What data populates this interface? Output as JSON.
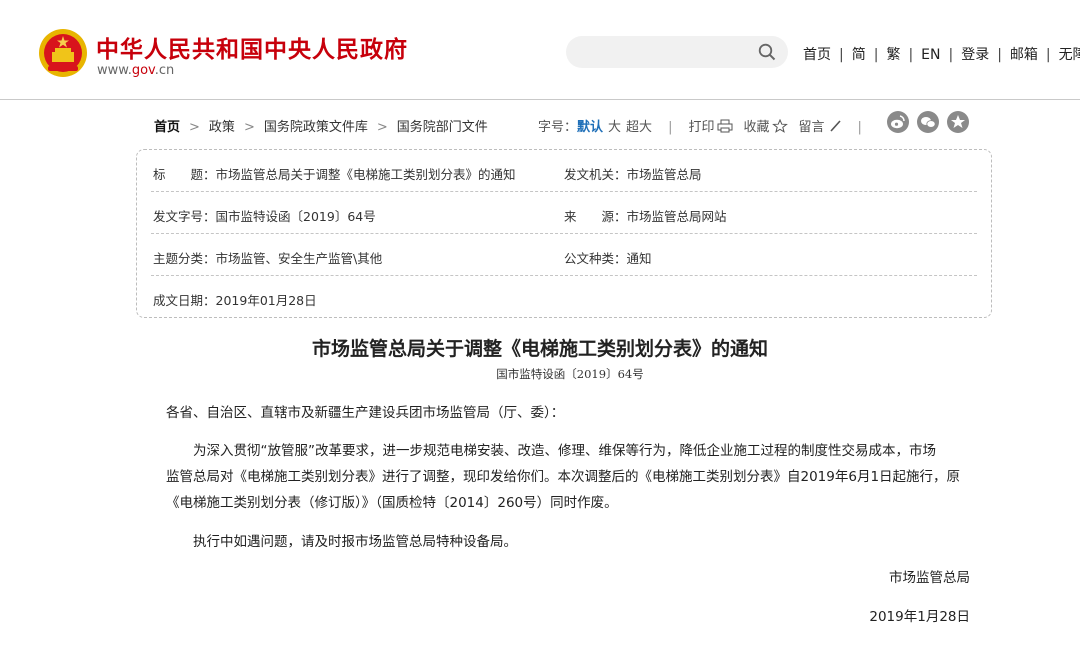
{
  "header": {
    "site_title": "中华人民共和国中央人民政府",
    "site_url_prefix": "www.",
    "site_url_domain": "gov",
    "site_url_suffix": ".cn",
    "nav": [
      "首页",
      "简",
      "繁",
      "EN",
      "登录",
      "邮箱",
      "无障碍"
    ],
    "search_placeholder": "",
    "colors": {
      "brand_red": "#c7000b",
      "link_blue": "#1f6fb8"
    }
  },
  "breadcrumb": [
    "首页",
    "政策",
    "国务院政策文件库",
    "国务院部门文件"
  ],
  "tools": {
    "font_label": "字号：",
    "font_default": "默认",
    "font_large": "大",
    "font_xlarge": "超大",
    "print": "打印",
    "favorite": "收藏",
    "comment": "留言",
    "share_icons": [
      "weibo-icon",
      "wechat-icon",
      "qzone-icon"
    ]
  },
  "info": {
    "title_key": "标　　题：",
    "title_val": "市场监管总局关于调整《电梯施工类别划分表》的通知",
    "issuer_key": "发文机关：",
    "issuer_val": "市场监管总局",
    "docno_key": "发文字号：",
    "docno_val": "国市监特设函〔2019〕64号",
    "source_key": "来　　源：",
    "source_val": "市场监管总局网站",
    "subject_key": "主题分类：",
    "subject_val": "市场监管、安全生产监管\\其他",
    "type_key": "公文种类：",
    "type_val": "通知",
    "date_key": "成文日期：",
    "date_val": "2019年01月28日"
  },
  "article": {
    "title": "市场监管总局关于调整《电梯施工类别划分表》的通知",
    "doc_no": "国市监特设函〔2019〕64号",
    "salutation": "各省、自治区、直辖市及新疆生产建设兵团市场监管局（厅、委）：",
    "para1_line1": "　　为深入贯彻“放管服”改革要求，进一步规范电梯安装、改造、修理、维保等行为，降低企业施工过程的制度性交易成本，市场",
    "para1_line2": "监管总局对《电梯施工类别划分表》进行了调整，现印发给你们。本次调整后的《电梯施工类别划分表》自2019年6月1日起施行，原",
    "para1_line3": "《电梯施工类别划分表（修订版）》（国质检特〔2014〕260号）同时作废。",
    "para2": "　　执行中如遇问题，请及时报市场监管总局特种设备局。",
    "signature": "市场监管总局",
    "sign_date": "2019年1月28日"
  }
}
